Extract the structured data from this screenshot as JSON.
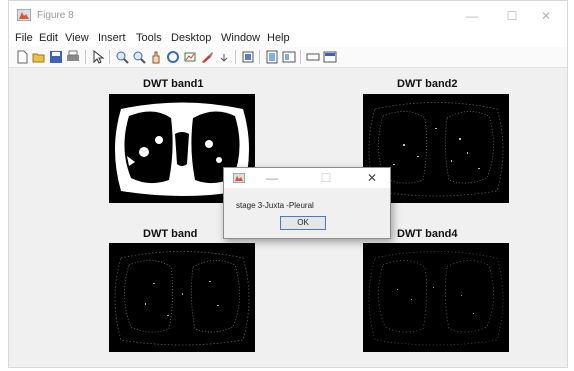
{
  "window": {
    "title": "Figure 8"
  },
  "menu": [
    "File",
    "Edit",
    "View",
    "Insert",
    "Tools",
    "Desktop",
    "Window",
    "Help"
  ],
  "toolbar_icons": [
    "new-figure-icon",
    "open-file-icon",
    "save-icon",
    "print-icon",
    "pointer-icon",
    "zoom-in-icon",
    "zoom-out-icon",
    "pan-icon",
    "rotate-3d-icon",
    "data-cursor-icon",
    "brush-icon",
    "link-plot-icon",
    "colorbar-icon",
    "legend-icon",
    "hide-plot-tools-icon",
    "show-plot-tools-icon"
  ],
  "plots": [
    {
      "title": "DWT band1"
    },
    {
      "title": "DWT band2"
    },
    {
      "title": "DWT band"
    },
    {
      "title": "DWT band4"
    }
  ],
  "dialog": {
    "message": "stage 3-Juxta -Pleural",
    "ok_label": "OK"
  }
}
